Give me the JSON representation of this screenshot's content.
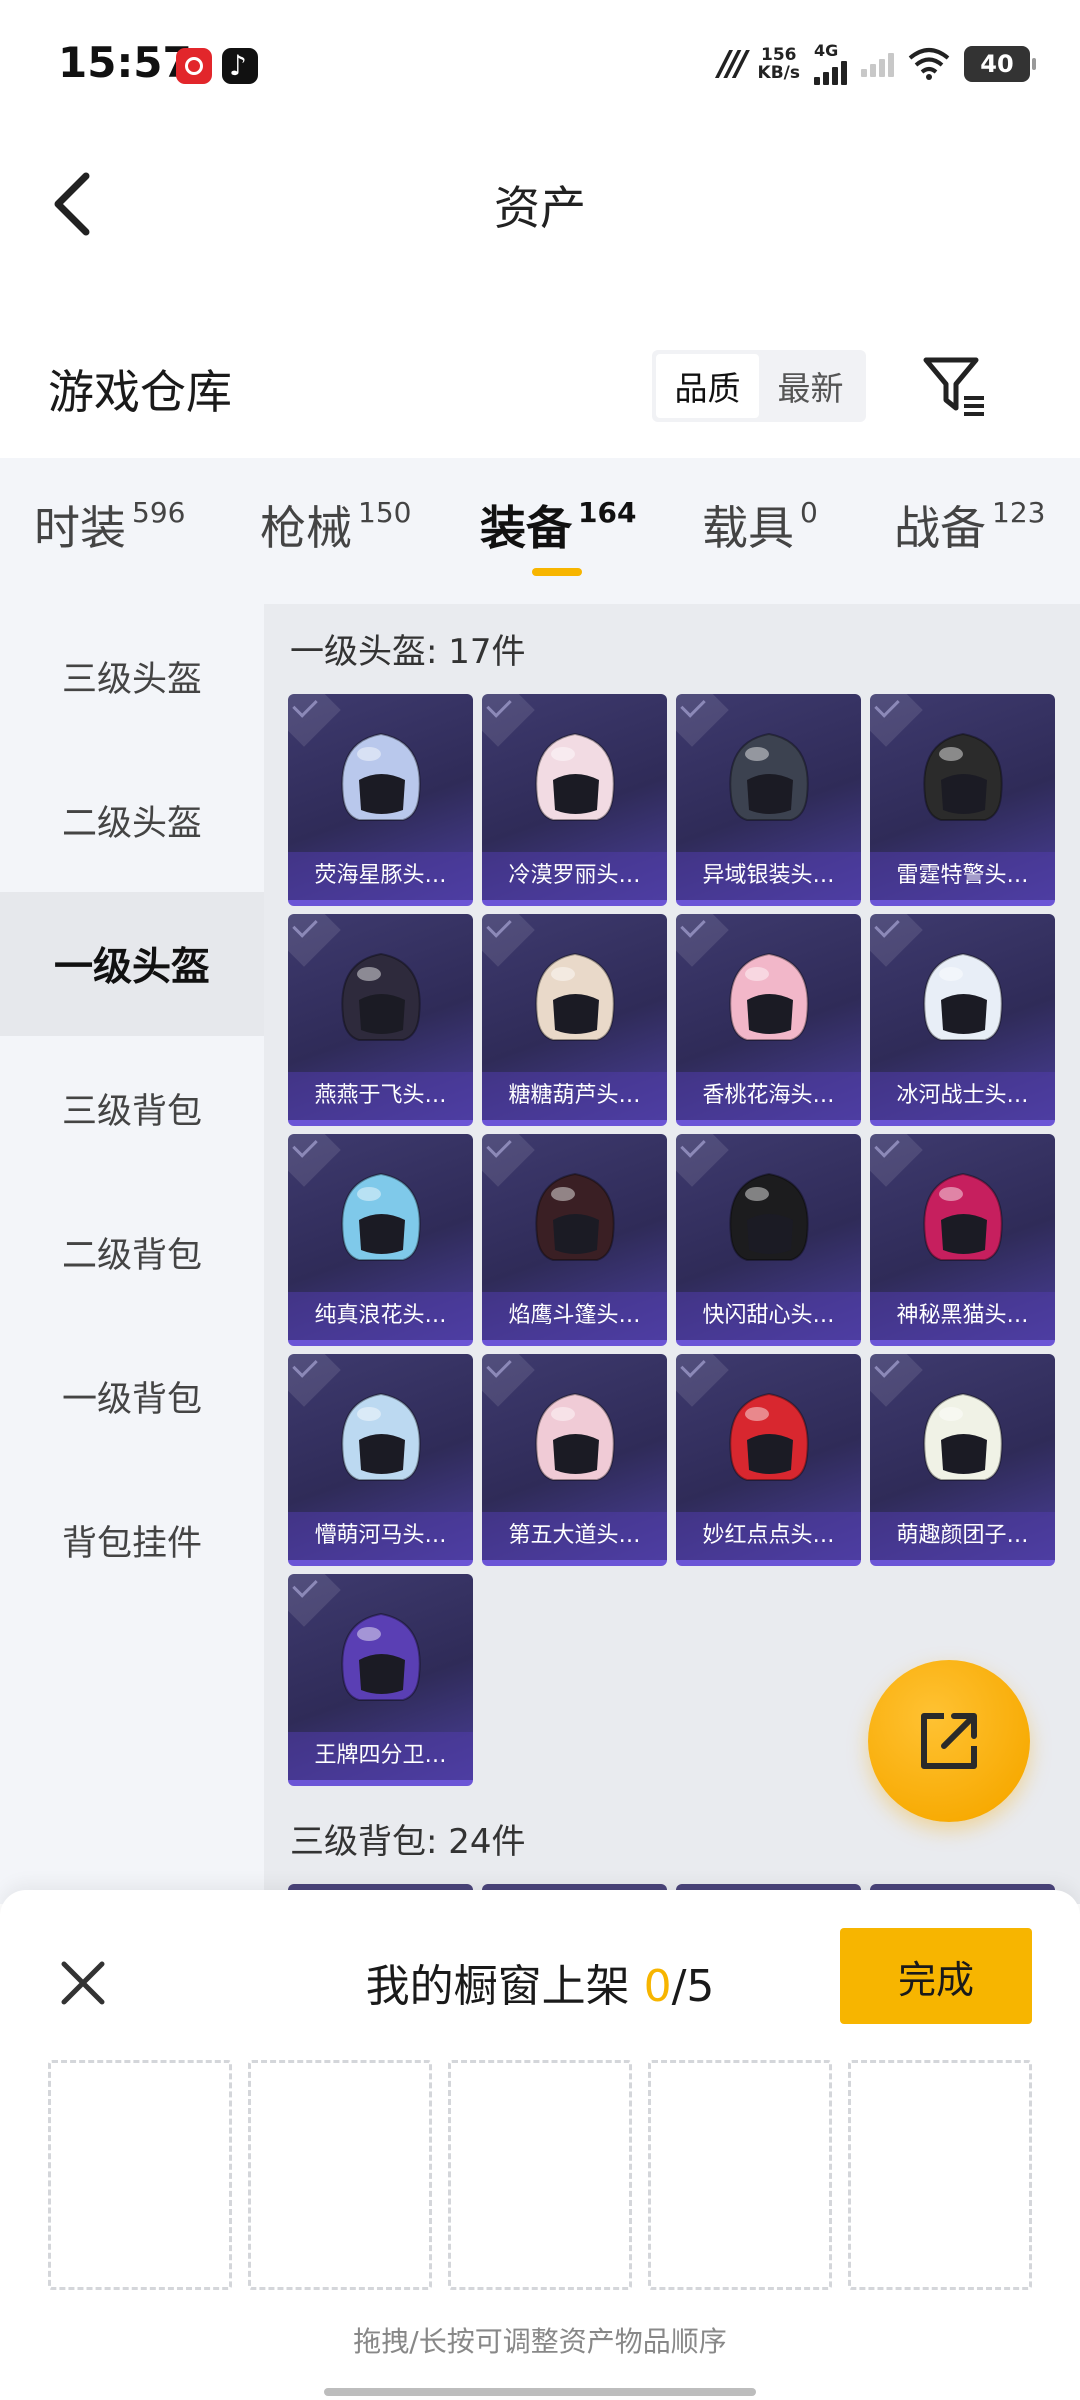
{
  "status_bar": {
    "time": "15:57",
    "net_speed_value": "156",
    "net_speed_unit": "KB/s",
    "network_type": "4G",
    "battery": "40",
    "icons": [
      "netease-music-icon",
      "tiktok-icon",
      "vpn-icon",
      "signal-icon",
      "wifi-icon",
      "battery-icon"
    ]
  },
  "header": {
    "title": "资产"
  },
  "warehouse": {
    "title": "游戏仓库",
    "sort_options": [
      "品质",
      "最新"
    ],
    "sort_selected": "品质"
  },
  "tabs": [
    {
      "label": "时装",
      "count": "596"
    },
    {
      "label": "枪械",
      "count": "150"
    },
    {
      "label": "装备",
      "count": "164"
    },
    {
      "label": "载具",
      "count": "0"
    },
    {
      "label": "战备",
      "count": "123"
    }
  ],
  "active_tab": "装备",
  "sidebar": {
    "items": [
      "三级头盔",
      "二级头盔",
      "一级头盔",
      "三级背包",
      "二级背包",
      "一级背包",
      "背包挂件"
    ],
    "active": "一级头盔"
  },
  "sections": [
    {
      "title": "一级头盔: 17件",
      "items": [
        {
          "name": "荧海星豚头…",
          "color": "#b9c8ec"
        },
        {
          "name": "冷漠罗丽头…",
          "color": "#f2dbe3"
        },
        {
          "name": "异域银装头…",
          "color": "#3c4250"
        },
        {
          "name": "雷霆特警头…",
          "color": "#2b2b2b"
        },
        {
          "name": "燕燕于飞头…",
          "color": "#2e2a3c"
        },
        {
          "name": "糖糖葫芦头…",
          "color": "#e9d9c9"
        },
        {
          "name": "香桃花海头…",
          "color": "#f2b7c9"
        },
        {
          "name": "冰河战士头…",
          "color": "#e8eef7"
        },
        {
          "name": "纯真浪花头…",
          "color": "#7fc9ea"
        },
        {
          "name": "焰鹰斗篷头…",
          "color": "#3a1f24"
        },
        {
          "name": "快闪甜心头…",
          "color": "#1c1c1e"
        },
        {
          "name": "神秘黑猫头…",
          "color": "#c61f5e"
        },
        {
          "name": "懵萌河马头…",
          "color": "#bcd9f1"
        },
        {
          "name": "第五大道头…",
          "color": "#f0cbd6"
        },
        {
          "name": "妙红点点头…",
          "color": "#d8272f"
        },
        {
          "name": "萌趣颜团子…",
          "color": "#f0f2e6"
        },
        {
          "name": "王牌四分卫…",
          "color": "#5a3fb4"
        }
      ]
    },
    {
      "title": "三级背包: 24件",
      "items": []
    }
  ],
  "share_fab": {
    "icon": "share-external-icon"
  },
  "showcase_sheet": {
    "title_prefix": "我的橱窗上架",
    "current": "0",
    "separator_total": "/5",
    "done_label": "完成",
    "slot_count": 5,
    "hint": "拖拽/长按可调整资产物品顺序",
    "accent_color": "#f7b500"
  }
}
